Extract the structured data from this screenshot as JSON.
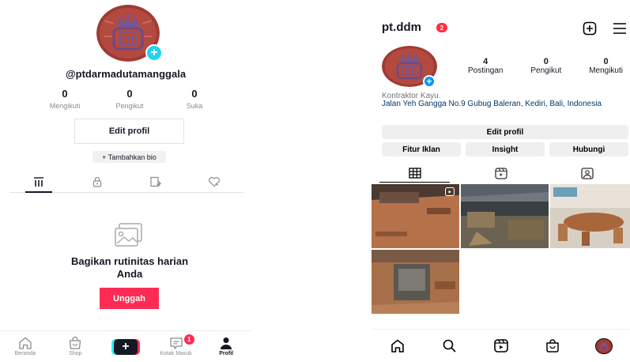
{
  "tiktok": {
    "username": "@ptdarmadutamanggala",
    "stats": [
      {
        "value": "0",
        "label": "Mengikuti"
      },
      {
        "value": "0",
        "label": "Pengikut"
      },
      {
        "value": "0",
        "label": "Suka"
      }
    ],
    "edit_profile_label": "Edit profil",
    "add_bio_label": "+ Tambahkan bio",
    "tabs": [
      {
        "icon": "grid-lines-icon",
        "active": true
      },
      {
        "icon": "lock-icon",
        "active": false
      },
      {
        "icon": "tagged-post-icon",
        "active": false
      },
      {
        "icon": "liked-heart-icon",
        "active": false
      }
    ],
    "empty_state": {
      "icon": "photo-gallery-icon",
      "title": "Bagikan rutinitas harian Anda",
      "button_label": "Unggah"
    },
    "nav": {
      "home_label": "Beranda",
      "shop_label": "Shop",
      "inbox_label": "Kotak Masuk",
      "inbox_badge": "1",
      "profile_label": "Profil"
    },
    "colors": {
      "accent": "#fe2c55",
      "cyan": "#25f4ee"
    }
  },
  "instagram": {
    "username": "pt.ddm",
    "notification_count": "2",
    "stats": [
      {
        "value": "4",
        "label": "Postingan"
      },
      {
        "value": "0",
        "label": "Pengikut"
      },
      {
        "value": "0",
        "label": "Mengikuti"
      }
    ],
    "category": "Kontraktor Kayu.",
    "address": "Jalan Yeh Gangga No.9 Gubug Baleran, Kediri, Bali, Indonesia",
    "buttons": {
      "edit_profile": "Edit profil",
      "ads": "Fitur Iklan",
      "insight": "Insight",
      "contact": "Hubungi"
    },
    "tabs": [
      {
        "icon": "grid-icon",
        "active": true
      },
      {
        "icon": "reels-icon",
        "active": false
      },
      {
        "icon": "tagged-icon",
        "active": false
      }
    ],
    "posts": [
      {
        "name": "post-workshop-floor",
        "is_reel": true
      },
      {
        "name": "post-warehouse-timber",
        "is_reel": false
      },
      {
        "name": "post-round-table",
        "is_reel": false
      },
      {
        "name": "post-machine",
        "is_reel": false
      }
    ],
    "nav_icons": [
      "home-icon",
      "search-icon",
      "reels-icon",
      "shop-icon",
      "profile-avatar"
    ],
    "colors": {
      "link": "#00376b",
      "badge": "#ff3040",
      "blue": "#0095f6"
    }
  }
}
